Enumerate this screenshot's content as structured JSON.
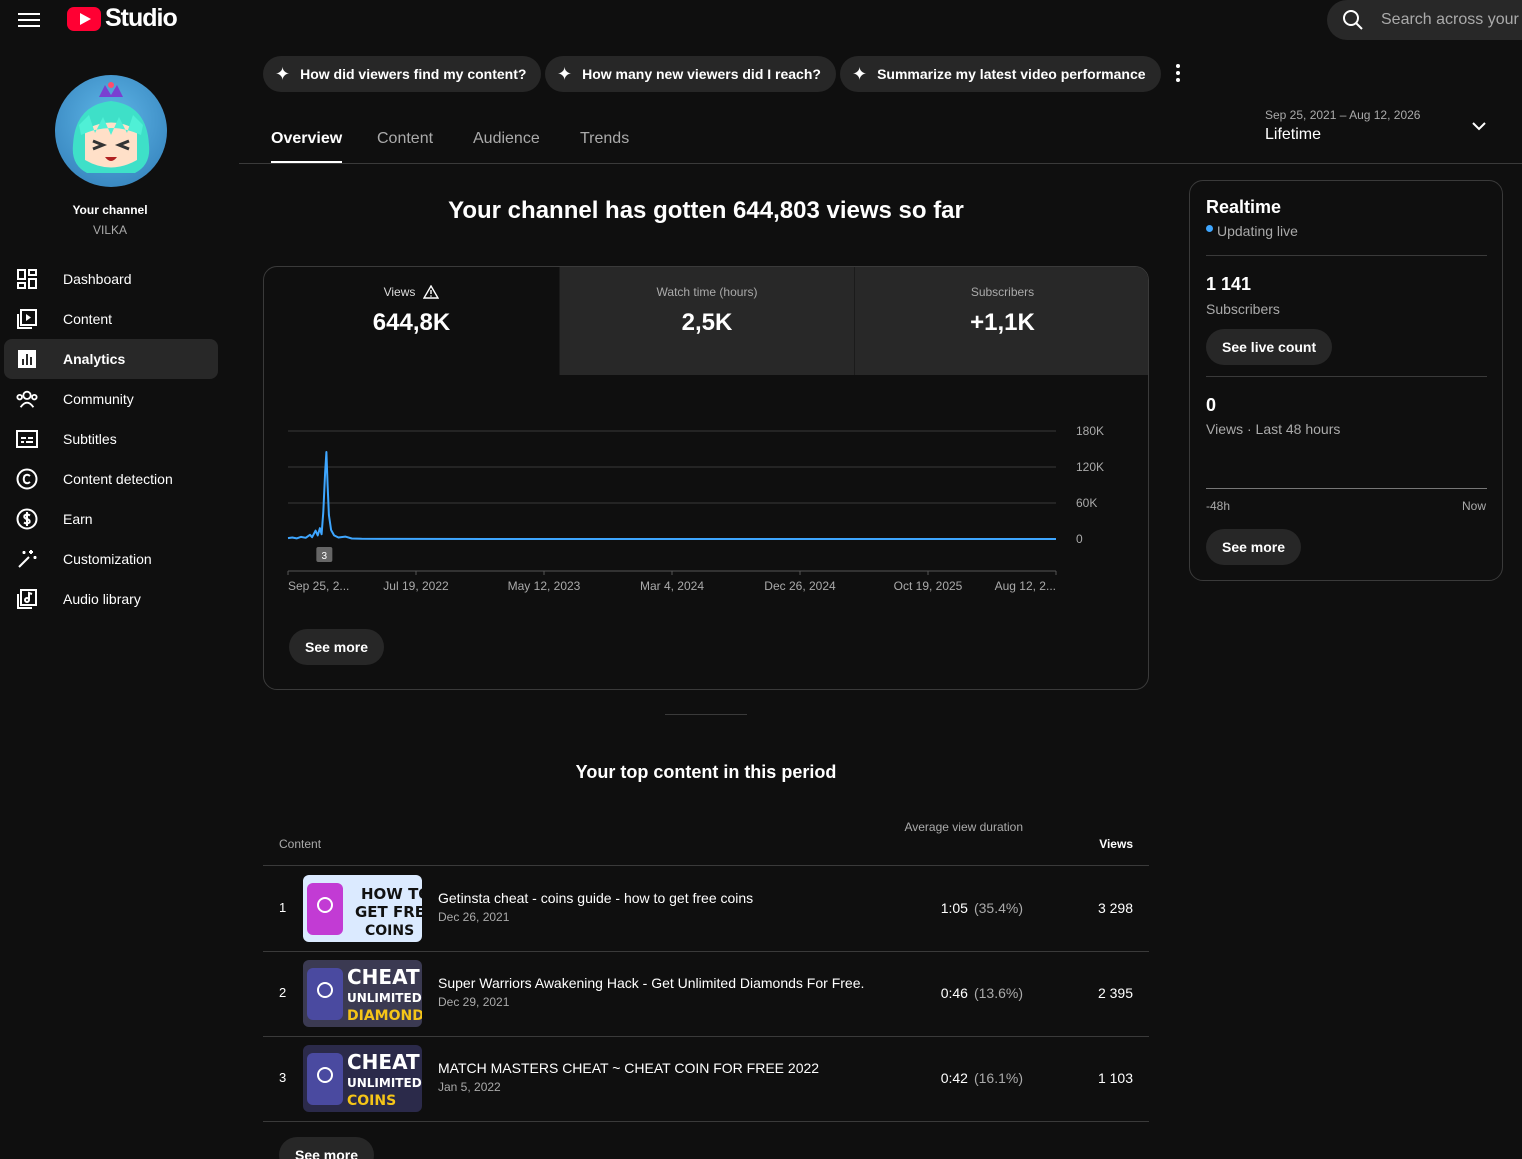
{
  "header": {
    "logo_text": "Studio",
    "search_placeholder": "Search across your channel"
  },
  "channel": {
    "name": "Your channel",
    "handle": "VILKA"
  },
  "sidebar": {
    "items": [
      {
        "label": "Dashboard",
        "icon": "dashboard-icon"
      },
      {
        "label": "Content",
        "icon": "content-icon"
      },
      {
        "label": "Analytics",
        "icon": "analytics-icon",
        "active": true
      },
      {
        "label": "Community",
        "icon": "community-icon"
      },
      {
        "label": "Subtitles",
        "icon": "subtitles-icon"
      },
      {
        "label": "Content detection",
        "icon": "copyright-icon"
      },
      {
        "label": "Earn",
        "icon": "dollar-icon"
      },
      {
        "label": "Customization",
        "icon": "magic-wand-icon"
      },
      {
        "label": "Audio library",
        "icon": "audio-library-icon"
      }
    ]
  },
  "chips": [
    "How did viewers find my content?",
    "How many new viewers did I reach?",
    "Summarize my latest video performance"
  ],
  "tabs": [
    "Overview",
    "Content",
    "Audience",
    "Trends"
  ],
  "date_range": {
    "range": "Sep 25, 2021 – Aug 12, 2026",
    "label": "Lifetime"
  },
  "headline": "Your channel has gotten 644,803 views so far",
  "metrics": [
    {
      "label": "Views",
      "value": "644,8K"
    },
    {
      "label": "Watch time (hours)",
      "value": "2,5K"
    },
    {
      "label": "Subscribers",
      "value": "+1,1K"
    }
  ],
  "chart_data": {
    "type": "line",
    "x_tick_labels": [
      "Sep 25, 2...",
      "Jul 19, 2022",
      "May 12, 2023",
      "Mar 4, 2024",
      "Dec 26, 2024",
      "Oct 19, 2025",
      "Aug 12, 2..."
    ],
    "y_tick_labels": [
      "180K",
      "120K",
      "60K",
      "0"
    ],
    "ylim": [
      0,
      180000
    ],
    "annotation_marker": "3",
    "series": [
      {
        "color": "#3ea6ff",
        "points": [
          {
            "x": "2021-09-25",
            "y": 1500
          },
          {
            "x": "2021-10-05",
            "y": 2500
          },
          {
            "x": "2021-10-15",
            "y": 1000
          },
          {
            "x": "2021-10-25",
            "y": 3500
          },
          {
            "x": "2021-11-05",
            "y": 2000
          },
          {
            "x": "2021-11-15",
            "y": 7000
          },
          {
            "x": "2021-11-20",
            "y": 3000
          },
          {
            "x": "2021-11-28",
            "y": 14000
          },
          {
            "x": "2021-12-03",
            "y": 6000
          },
          {
            "x": "2021-12-08",
            "y": 18000
          },
          {
            "x": "2021-12-12",
            "y": 8000
          },
          {
            "x": "2021-12-16",
            "y": 45000
          },
          {
            "x": "2021-12-20",
            "y": 110000
          },
          {
            "x": "2021-12-23",
            "y": 145000
          },
          {
            "x": "2021-12-26",
            "y": 90000
          },
          {
            "x": "2021-12-29",
            "y": 40000
          },
          {
            "x": "2022-01-03",
            "y": 15000
          },
          {
            "x": "2022-01-10",
            "y": 6000
          },
          {
            "x": "2022-01-20",
            "y": 2500
          },
          {
            "x": "2022-02-05",
            "y": 4000
          },
          {
            "x": "2022-02-20",
            "y": 800
          },
          {
            "x": "2022-03-15",
            "y": 300
          },
          {
            "x": "2022-06-01",
            "y": 100
          },
          {
            "x": "2023-01-01",
            "y": 50
          },
          {
            "x": "2024-06-01",
            "y": 20
          },
          {
            "x": "2025-06-01",
            "y": 10
          },
          {
            "x": "2026-08-12",
            "y": 0
          }
        ]
      }
    ],
    "grid": true
  },
  "see_more": "See more",
  "realtime": {
    "title": "Realtime",
    "status": "Updating live",
    "subscribers_value": "1 141",
    "subscribers_label": "Subscribers",
    "live_count_button": "See live count",
    "views_value": "0",
    "views_label": "Views · Last 48 hours",
    "axis_start": "-48h",
    "axis_end": "Now",
    "see_more": "See more"
  },
  "top_content": {
    "title": "Your top content in this period",
    "col_content": "Content",
    "col_avd": "Average view duration",
    "col_views": "Views",
    "rows": [
      {
        "rank": "1",
        "title": "Getinsta cheat - coins guide - how to get free coins",
        "date": "Dec 26, 2021",
        "avd": "1:05",
        "pct": "(35.4%)",
        "views": "3 298",
        "thumb": {
          "lines": [
            "HOW TO",
            "GET FREE",
            "COINS"
          ],
          "bg": "#dbeaff"
        }
      },
      {
        "rank": "2",
        "title": "Super Warriors Awakening Hack - Get Unlimited Diamonds For Free.",
        "date": "Dec 29, 2021",
        "avd": "0:46",
        "pct": "(13.6%)",
        "views": "2 395",
        "thumb": {
          "lines": [
            "CHEAT",
            "UNLIMITED",
            "DIAMONDS"
          ],
          "bg": "#3b3a52"
        }
      },
      {
        "rank": "3",
        "title": "MATCH MASTERS CHEAT ~ CHEAT COIN FOR FREE 2022",
        "date": "Jan 5, 2022",
        "avd": "0:42",
        "pct": "(16.1%)",
        "views": "1 103",
        "thumb": {
          "lines": [
            "CHEAT",
            "UNLIMITED",
            "COINS"
          ],
          "bg": "#2b2a4a"
        }
      }
    ],
    "see_more": "See more"
  }
}
